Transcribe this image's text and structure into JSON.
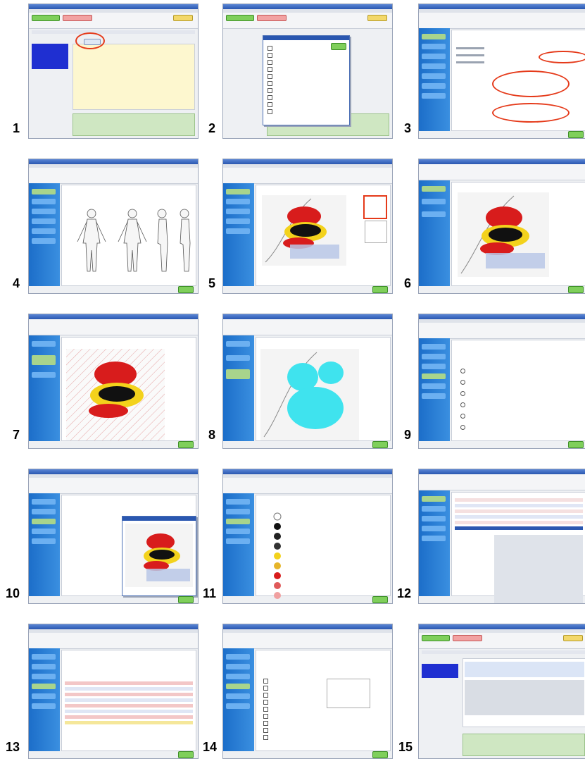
{
  "steps": [
    {
      "number": "1"
    },
    {
      "number": "2"
    },
    {
      "number": "3"
    },
    {
      "number": "4"
    },
    {
      "number": "5"
    },
    {
      "number": "6"
    },
    {
      "number": "7"
    },
    {
      "number": "8"
    },
    {
      "number": "9"
    },
    {
      "number": "10"
    },
    {
      "number": "11"
    },
    {
      "number": "12"
    },
    {
      "number": "13"
    },
    {
      "number": "14"
    },
    {
      "number": "15"
    }
  ],
  "colors": {
    "title_bar": "#2a57b0",
    "nav_panel": "#1c6ec9",
    "accent_ring": "#e53a1a",
    "ok_button": "#7fcf5b",
    "wound_red": "#d81c1c",
    "wound_yellow": "#f3d21c",
    "wound_black": "#111111",
    "wound_cyan": "#3fe3ee",
    "note_pane": "#fdf7cf",
    "patient_list": "#1f2fd1"
  }
}
